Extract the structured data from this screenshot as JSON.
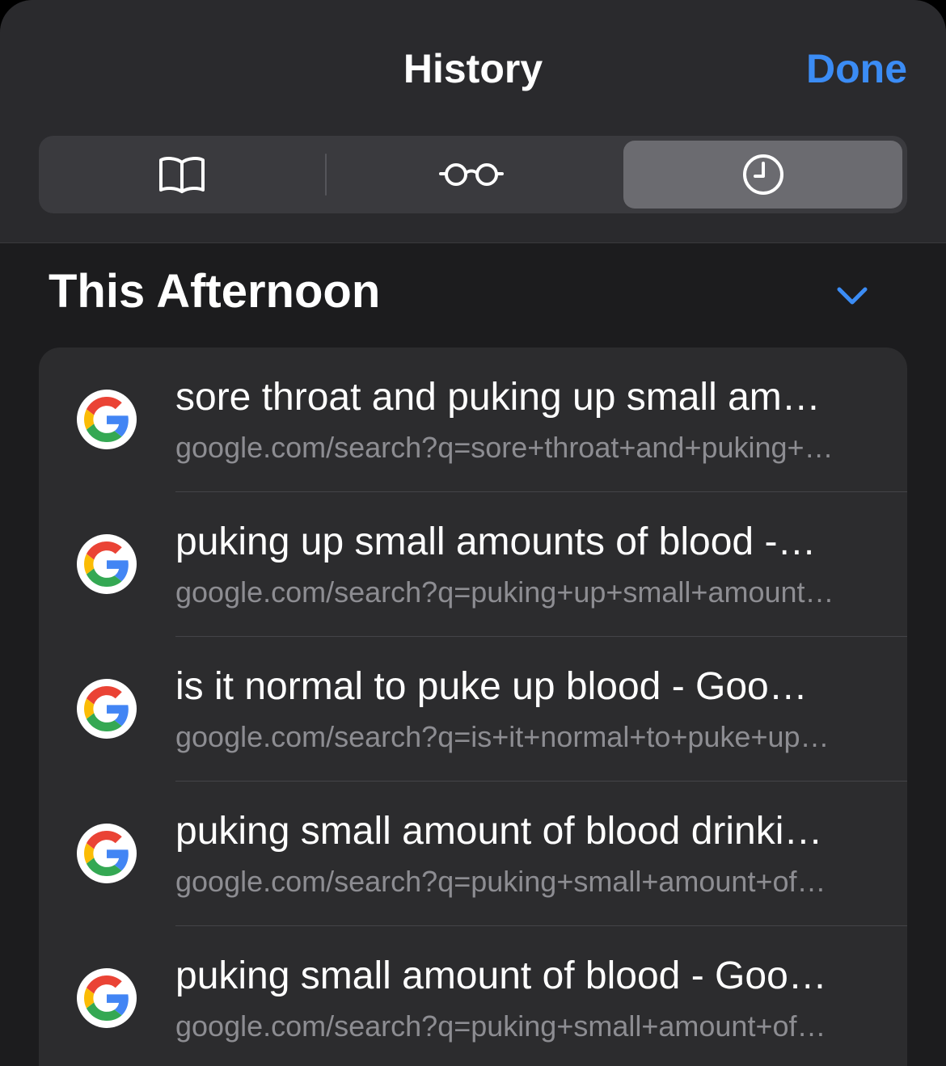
{
  "header": {
    "title": "History",
    "done_label": "Done"
  },
  "segments": [
    {
      "icon": "book-icon",
      "selected": false
    },
    {
      "icon": "glasses-icon",
      "selected": false
    },
    {
      "icon": "clock-icon",
      "selected": true
    }
  ],
  "section": {
    "title": "This Afternoon",
    "icon": "chevron-down-icon",
    "accent": "#3b8cf5"
  },
  "history": [
    {
      "title": "sore throat and puking up small am…",
      "url": "google.com/search?q=sore+throat+and+puking+…",
      "icon": "google-icon"
    },
    {
      "title": "puking up small amounts of blood -…",
      "url": "google.com/search?q=puking+up+small+amount…",
      "icon": "google-icon"
    },
    {
      "title": "is it normal to puke up blood - Goo…",
      "url": "google.com/search?q=is+it+normal+to+puke+up…",
      "icon": "google-icon"
    },
    {
      "title": "puking small amount of blood drinki…",
      "url": "google.com/search?q=puking+small+amount+of…",
      "icon": "google-icon"
    },
    {
      "title": "puking small amount of blood - Goo…",
      "url": "google.com/search?q=puking+small+amount+of…",
      "icon": "google-icon"
    }
  ]
}
